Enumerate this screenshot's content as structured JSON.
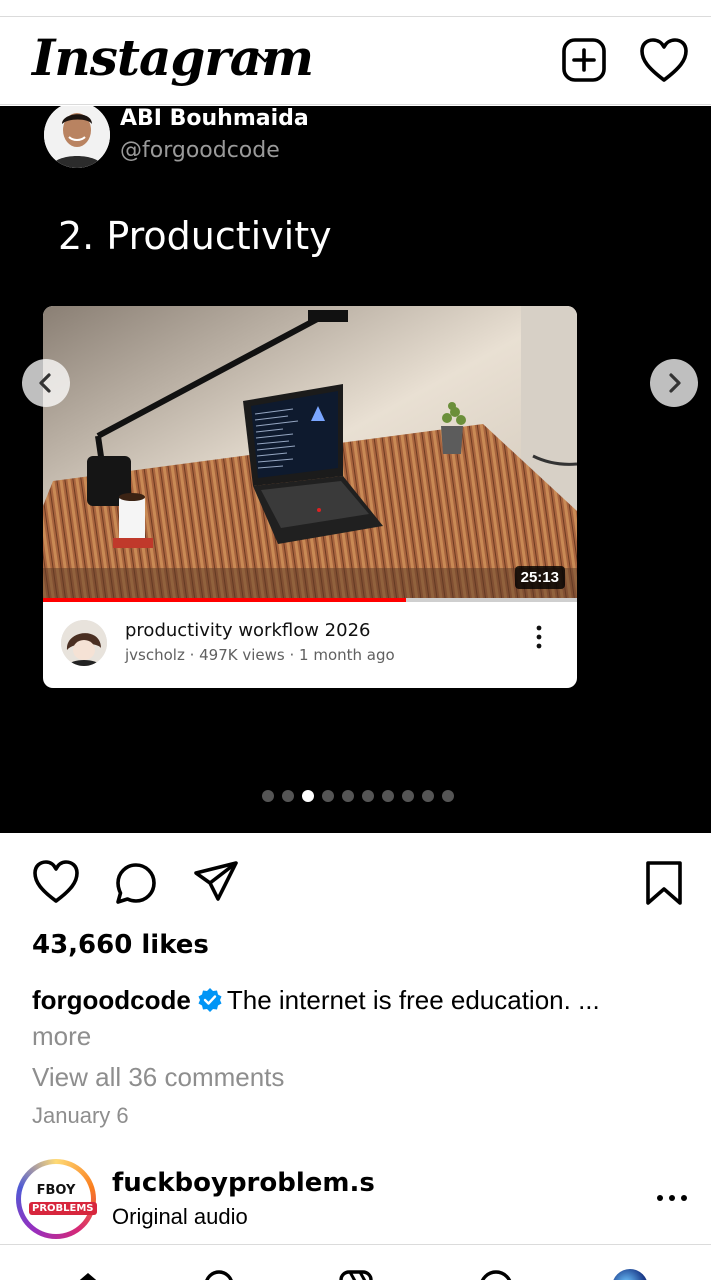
{
  "header": {
    "logo": "Instagram",
    "icons": [
      "chevron-down-icon",
      "plus-square-icon",
      "heart-icon"
    ]
  },
  "post": {
    "slide": {
      "author_name": "ABI Bouhmaida",
      "author_handle": "@forgoodcode",
      "title": "2. Productivity",
      "video": {
        "duration": "25:13",
        "progress": 0.68,
        "title": "productivity workflow 2026",
        "meta": "jvscholz · 497K views · 1 month ago"
      }
    },
    "carousel": {
      "total": 10,
      "active_index": 2
    },
    "likes": "43,660 likes",
    "caption": {
      "username": "forgoodcode",
      "text": "The internet is free education. ...",
      "more": "more"
    },
    "view_comments": "View all 36 comments",
    "date": "January 6"
  },
  "next_post": {
    "avatar_line1": "FBOY",
    "avatar_line2": "PROBLEMS",
    "username": "fuckboyproblem.s",
    "subtitle": "Original audio"
  },
  "colors": {
    "accent_red": "#ff0000",
    "verified_blue": "#0095f6",
    "muted": "#8e8e8e"
  }
}
